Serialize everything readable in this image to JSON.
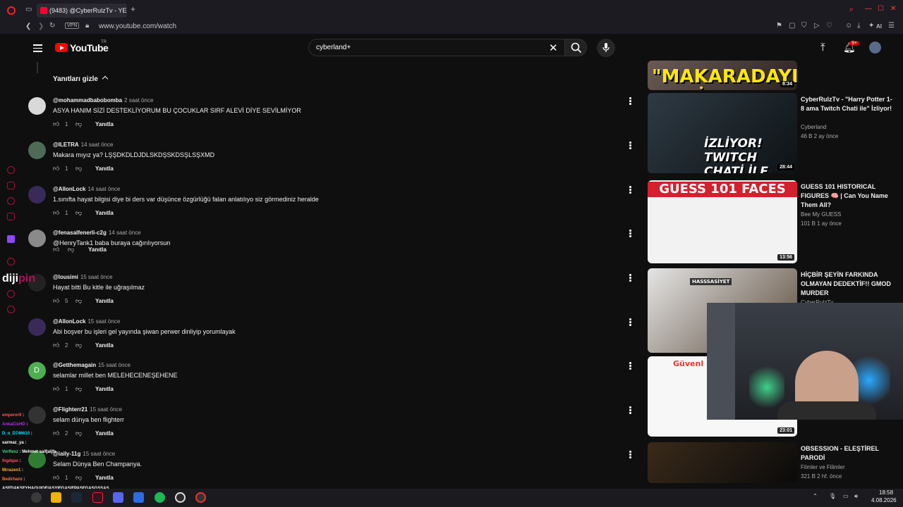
{
  "browser": {
    "tab_title": "(9483) @CyberRulzTv - YE",
    "url": "www.youtube.com/watch",
    "vpn_label": "VPN",
    "ai_label": "AI"
  },
  "header": {
    "logo_text": "YouTube",
    "region": "TR",
    "search_value": "cyberland+",
    "notification_count": "9+"
  },
  "comments": {
    "hide_replies_label": "Yanıtları gizle",
    "reply_label": "Yanıtla",
    "items": [
      {
        "author": "@mohammadbabobomba",
        "time": "2 saat önce",
        "text": "ASYA HANIM SİZİ DESTEKLİYORUM BU ÇOCUKLAR SIRF ALEVİ DİYE SEVİLMİYOR",
        "likes": "1",
        "avatar_color": "#d9d9d9"
      },
      {
        "author": "@ILETRA",
        "time": "14 saat önce",
        "text": "Makara mıyız ya? LŞŞDKDLDJDLSKDŞSKDSŞLSŞXMD",
        "likes": "1",
        "avatar_color": "#4d6b56"
      },
      {
        "author": "@AllonLock",
        "time": "14 saat önce",
        "text": "1.sınıfta hayat bilgisi diye bi ders var düşünce özgürlüğü falan anlatılıyo siz görmediniz heralde",
        "likes": "1",
        "avatar_color": "#3a2a5a"
      },
      {
        "author": "@fenasalfenerli-c2g",
        "time": "14 saat önce",
        "text": "@HenryTank1 baba buraya cağırılıyorsun",
        "likes": "",
        "avatar_color": "#8a8a8a"
      },
      {
        "author": "@lousimi",
        "time": "15 saat önce",
        "text": "Hayat bitti Bu kitle ile uğraşılmaz",
        "likes": "5",
        "avatar_color": "#222222"
      },
      {
        "author": "@AllonLock",
        "time": "15 saat önce",
        "text": "Abi boşver bu işleri gel yayında şiwan perwer dinliyip yorumlayak",
        "likes": "2",
        "avatar_color": "#3a2a5a"
      },
      {
        "author": "@Getthemagain",
        "time": "15 saat önce",
        "text": "selamlar millet ben MELEHECENEŞEHENE",
        "likes": "1",
        "avatar_color": "#4caf50",
        "initial": "D"
      },
      {
        "author": "@Flighterr21",
        "time": "15 saat önce",
        "text": "selam dünya ben flighterr",
        "likes": "2",
        "avatar_color": "#333333"
      },
      {
        "author": "@iaily-11g",
        "time": "15 saat önce",
        "text": "Selam Dünya Ben Champanya.",
        "likes": "1",
        "avatar_color": "#2e7d32"
      }
    ]
  },
  "sidebar": {
    "items": [
      {
        "title": "",
        "overlay_text": "\"MAKARADAYIZ DEMİ AYHAN ABİ\" İZLİYOR",
        "duration": "8:34",
        "channel": "",
        "meta": ""
      },
      {
        "title": "CyberRulzTv - \"Harry Potter 1-8 ama Twitch Chati ile\" İzliyor!",
        "overlay_text": "İZLİYOR! TWITCH CHATİ İLE HARRY POTTER!",
        "duration": "28:44",
        "channel": "Cyberland",
        "meta": "46 B  2 ay önce"
      },
      {
        "title": "GUESS 101 HISTORICAL FIGURES 🧠 | Can You Name Them All?",
        "overlay_text": "GUESS 101 FACES",
        "duration": "13:56",
        "channel": "Bee My GUESS",
        "meta": "101 B  1 ay önce"
      },
      {
        "title": "HİÇBİR ŞEYİN FARKINDA OLMAYAN DEDEKTİF!! GMOD MURDER",
        "overlay_text": "HASSSASİYET",
        "duration": "",
        "channel": "CyberRulzTv",
        "meta": ""
      },
      {
        "title": "",
        "overlay_text": "Güvenl",
        "duration": "23:01",
        "channel": "",
        "meta": ""
      },
      {
        "title": "OBSESSION - ELEŞTİREL PARODİ",
        "overlay_text": "",
        "duration": "",
        "channel": "Filmler ve Filimler",
        "meta": "321 B  2 hf. önce"
      }
    ]
  },
  "overlay": {
    "diji_text": "diji",
    "chat": [
      {
        "user": "emperor9",
        "msg": "",
        "color": "#ff5555"
      },
      {
        "user": "AnkaCixHD",
        "msg": "",
        "color": "#b02fff"
      },
      {
        "user": "D_o_D746610",
        "msg": "",
        "color": "#00e5ff"
      },
      {
        "user": "sarmaz_ya",
        "msg": "",
        "color": "#ffffff"
      },
      {
        "user": "Vorflexz",
        "msg": "Mehmet saifjaljfs",
        "color": "#3ddc84"
      },
      {
        "user": "lhgdqas",
        "msg": "",
        "color": "#ff4d6d"
      },
      {
        "user": "Mrrazen1",
        "msg": "",
        "color": "#ffb020"
      },
      {
        "user": "Bedirhanz",
        "msg": "",
        "color": "#ff7043"
      },
      {
        "user": "",
        "msg": "ASFDAKŞFYHAGUIOFIASYIFGASIFPASFGASGSSAS",
        "color": "#ffffff"
      }
    ]
  },
  "taskbar": {
    "time": "18:58",
    "date": "4.08.2026"
  }
}
